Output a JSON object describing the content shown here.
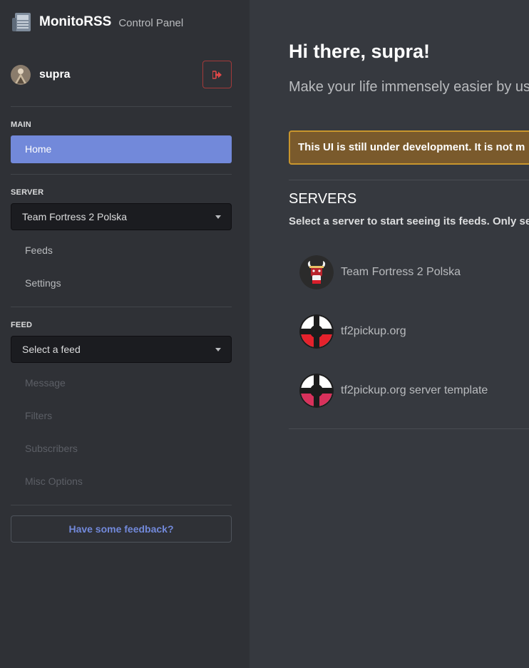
{
  "brand": {
    "name": "MonitoRSS",
    "subtitle": "Control Panel"
  },
  "user": {
    "name": "supra"
  },
  "sidebar": {
    "main_label": "MAIN",
    "home": "Home",
    "server_label": "SERVER",
    "server_select": "Team Fortress 2 Polska",
    "server_items": [
      "Feeds",
      "Settings"
    ],
    "feed_label": "FEED",
    "feed_select": "Select a feed",
    "feed_items": [
      "Message",
      "Filters",
      "Subscribers",
      "Misc Options"
    ],
    "feedback": "Have some feedback?"
  },
  "main": {
    "greeting": "Hi there, supra!",
    "lead": "Make your life immensely easier by usi",
    "alert": "This UI is still under development. It is not m",
    "servers_title": "SERVERS",
    "servers_sub": "Select a server to start seeing its feeds. Only se",
    "servers": [
      {
        "name": "Team Fortress 2 Polska"
      },
      {
        "name": "tf2pickup.org"
      },
      {
        "name": "tf2pickup.org server template"
      }
    ]
  },
  "colors": {
    "accent": "#7289da",
    "sidebar_bg": "#2f3136",
    "main_bg": "#36393f",
    "warning": "#c9962d",
    "danger": "#a33a3a"
  }
}
